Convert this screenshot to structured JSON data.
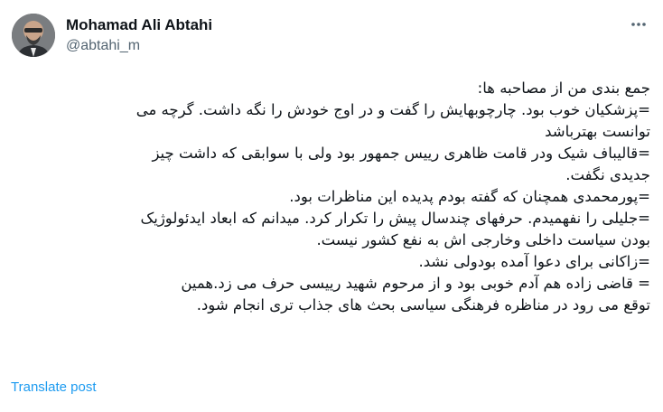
{
  "author": {
    "display_name": "Mohamad Ali Abtahi",
    "handle": "@abtahi_m"
  },
  "more_icon": "more-horizontal-icon",
  "tweet_lines": [
    "جمع بندی من از مصاحبه ها:",
    "=پزشکیان خوب بود. چارچوبهایش را گفت و در اوج خودش را نگه داشت. گرچه می",
    "توانست بهترباشد",
    "=قالیباف شیک ودر قامت ظاهری رییس جمهور بود ولی با سوابقی که داشت  چیز",
    "جدیدی نگفت.",
    "=پورمحمدی همچنان که گفته بودم پدیده این مناظرات بود.",
    "=جلیلی را نفهمیدم. حرفهای چندسال پیش را تکرار کرد. میدانم که ابعاد ایدئولوژیک",
    "بودن سیاست داخلی وخارجی اش به نفع کشور نیست.",
    "=زاکانی برای دعوا آمده بودولی نشد.",
    "= قاضی زاده هم آدم خوبی بود و از مرحوم شهید رییسی حرف می زد.همین",
    "توقع می رود در مناظره فرهنگی سیاسی بحث های جذاب تری انجام شود."
  ],
  "translate_label": "Translate post",
  "colors": {
    "link": "#1d9bf0",
    "secondary_text": "#536471",
    "primary_text": "#0f1419"
  }
}
